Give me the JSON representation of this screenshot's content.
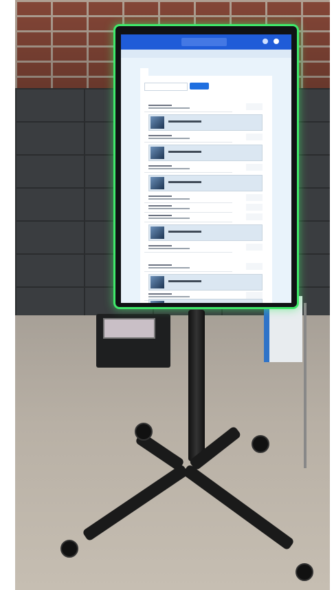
{
  "scene": {
    "caption": "",
    "colors": {
      "bezel_glow": "#3fe96a",
      "app_header": "#1f5cd8",
      "screen_bg": "#e9f3fb"
    }
  },
  "screen_ui": {
    "logo": "",
    "search": "",
    "sublink": "",
    "tabs": [
      "",
      ""
    ],
    "filter_select": "",
    "filter_button": "",
    "filter_link": "",
    "section_labels": [
      "",
      ""
    ]
  }
}
